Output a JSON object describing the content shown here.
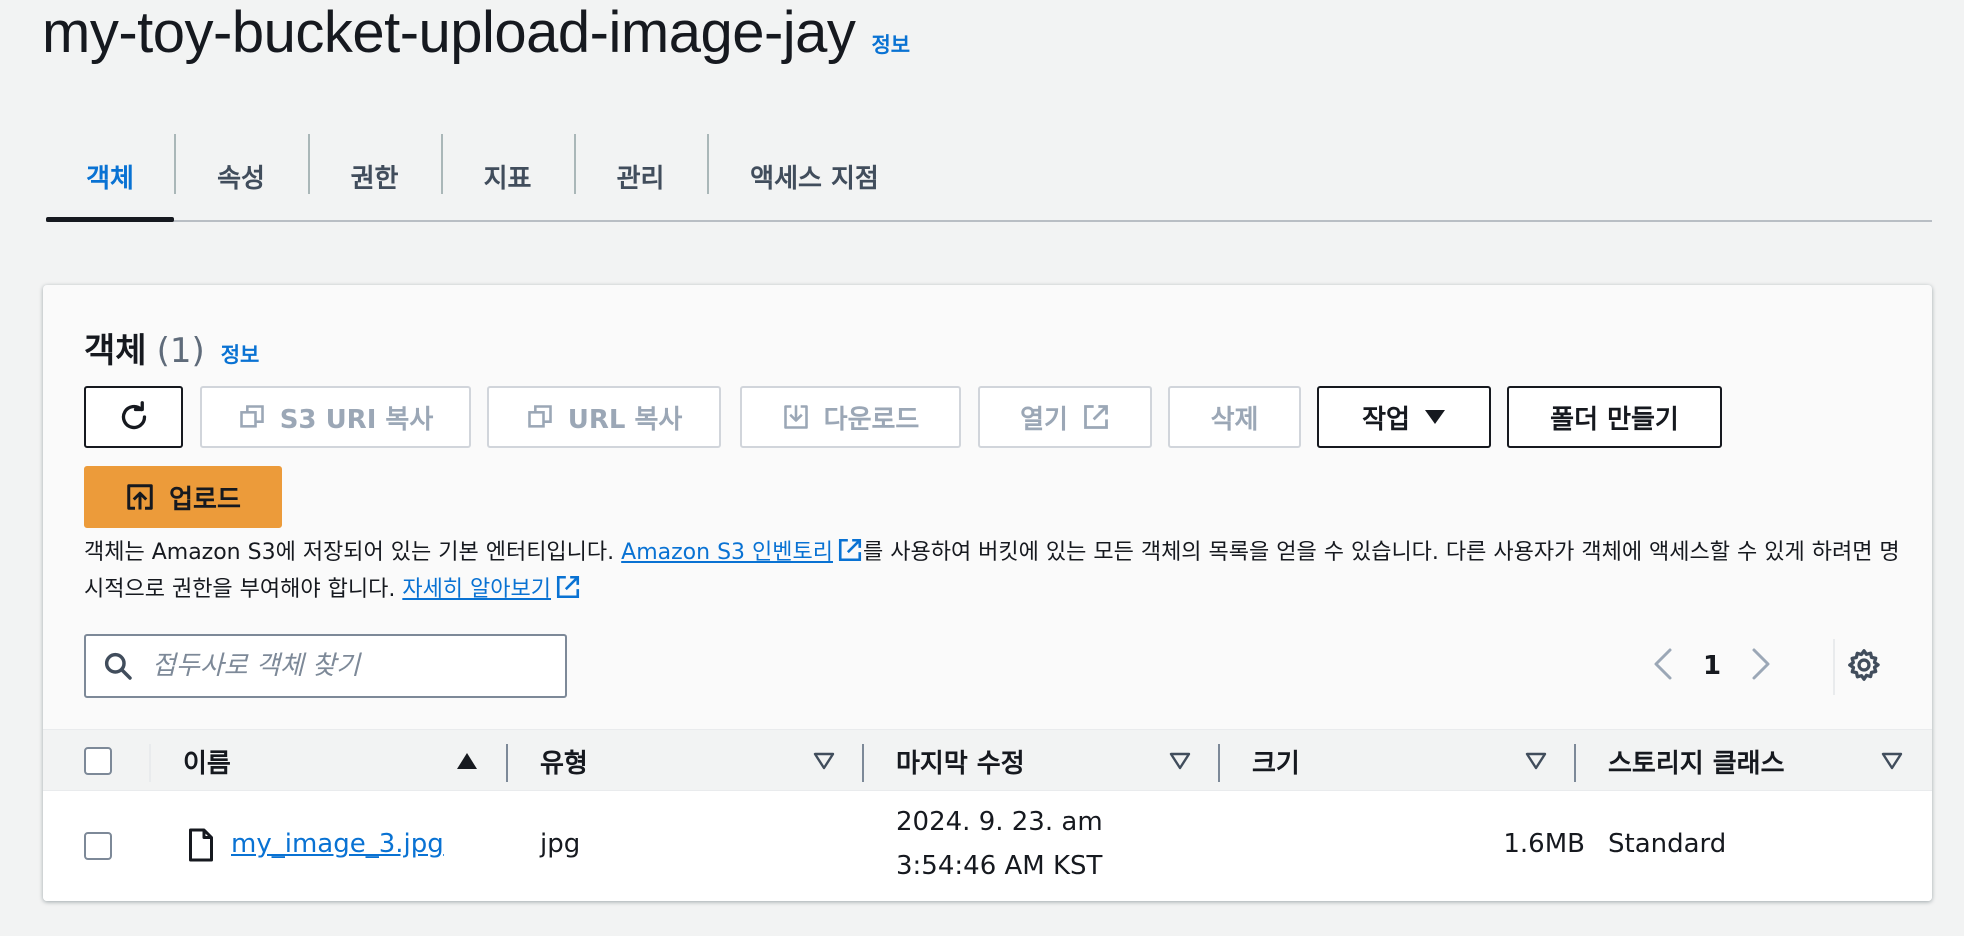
{
  "header": {
    "title": "my-toy-bucket-upload-image-jay",
    "info": "정보"
  },
  "tabs": [
    {
      "label": "객체",
      "active": true
    },
    {
      "label": "속성"
    },
    {
      "label": "권한"
    },
    {
      "label": "지표"
    },
    {
      "label": "관리"
    },
    {
      "label": "액세스 지점"
    }
  ],
  "objects_panel": {
    "title": "객체",
    "count": "(1)",
    "info": "정보",
    "buttons": {
      "copy_s3_uri": "S3 URI 복사",
      "copy_url": "URL 복사",
      "download": "다운로드",
      "open": "열기",
      "delete": "삭제",
      "actions": "작업",
      "create_folder": "폴더 만들기",
      "upload": "업로드"
    },
    "description": {
      "text1": "객체는 Amazon S3에 저장되어 있는 기본 엔터티입니다. ",
      "link1": "Amazon S3 인벤토리",
      "text2": "를 사용하여 버킷에 있는 모든 객체의 목록을 얻을 수 있습니다. 다른 사용자가 객체에 액세스할 수 있게 하려면 명시적으로 권한을 부여해야 합니다. ",
      "link2": "자세히 알아보기"
    },
    "search": {
      "placeholder": "접두사로 객체 찾기",
      "value": ""
    },
    "pagination": {
      "current_page": "1"
    },
    "table": {
      "columns": [
        "이름",
        "유형",
        "마지막 수정",
        "크기",
        "스토리지 클래스"
      ],
      "rows": [
        {
          "name": "my_image_3.jpg",
          "type": "jpg",
          "last_modified_line1": "2024. 9. 23. am",
          "last_modified_line2": "3:54:46 AM KST",
          "size": "1.6MB",
          "storage_class": "Standard"
        }
      ]
    }
  },
  "colors": {
    "link": "#0972d3",
    "primary_button": "#ec9b3a",
    "text": "#16191f",
    "background": "#f2f3f3"
  },
  "icons": [
    "refresh-icon",
    "copy-icon",
    "download-icon",
    "external-link-icon",
    "caret-down-icon",
    "upload-icon",
    "search-icon",
    "chevron-left-icon",
    "chevron-right-icon",
    "gear-icon",
    "sort-asc-icon",
    "sort-desc-icon",
    "file-icon"
  ]
}
